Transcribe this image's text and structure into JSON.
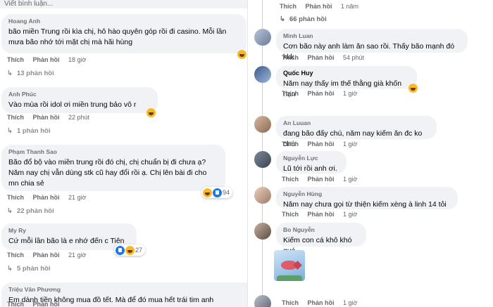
{
  "left": {
    "write_placeholder": "Viết bình luận...",
    "comments": [
      {
        "author": "Hoang Anh",
        "text": "bão miền Trung rồi kìa chị, hô hào quyên góp rồi đi casino. Mỗi lần mưa bão nhớ tới mặt chị mà hãi hùng",
        "like": "Thích",
        "reply": "Phản hồi",
        "time": "18 giờ",
        "replies": "13 phản hồi"
      },
      {
        "author": "Anh Phúc",
        "text": "Vào mùa rồi idol ơi miền trung bảo vô r",
        "like": "Thích",
        "reply": "Phản hồi",
        "time": "22 phút",
        "replies": "1 phản hồi"
      },
      {
        "author": "Phạm Thanh Sao",
        "text": "Bão đổ bộ vào miền trung rồi đó chị, chị chuẩn bị đi chưa ạ? Năm nay chị vẫn dùng stk cũ hay đổi rồi ạ. Chị lên bài đi cho mn chia sẻ",
        "like": "Thích",
        "reply": "Phản hồi",
        "time": "21 giờ",
        "reaction_count": "94",
        "replies": "22 phản hồi"
      },
      {
        "author": "My Ry",
        "text": "Cứ mỗi lần bão là e nhớ đến c Tiên",
        "like": "Thích",
        "reply": "Phản hồi",
        "time": "21 giờ",
        "reaction_count": "27",
        "replies": "5 phản hồi"
      },
      {
        "author": "Triệu Văn Phương",
        "text": "Em dành tiền không mua đồ tết. Mà để đó mua hết trái tim anh",
        "like": "Thích",
        "reply": "Phản hồi"
      }
    ]
  },
  "right": {
    "top": {
      "like": "Thích",
      "reply": "Phản hồi",
      "time": "1 năm",
      "replies": "66 phản hồi"
    },
    "comments": [
      {
        "author": "Minh Luan",
        "text": "Cơn bão này anh làm ăn sao rồi. Thấy bão mạnh đó kkk",
        "like": "Thích",
        "reply": "Phản hồi",
        "time": "54 phút"
      },
      {
        "author": "Quốc Huy",
        "text": "Năm nay thấy im thế thằng già khốn nạn",
        "like": "Thích",
        "reply": "Phản hồi",
        "time": "1 giờ"
      },
      {
        "author": "An Luuan",
        "text": "đang bão đấy chú, năm nay kiếm ăn đc ko chú",
        "like": "Thích",
        "reply": "Phản hồi",
        "time": "1 giờ"
      },
      {
        "author": "Nguyễn Lực",
        "text": "Lũ tới rồi anh ơi.",
        "like": "Thích",
        "reply": "Phản hồi",
        "time": "1 giờ"
      },
      {
        "author": "Nguyễn Hùng",
        "text": "Năm nay chưa gọi từ thiện kiếm xèng à linh 14 tỏi",
        "like": "Thích",
        "reply": "Phản hồi",
        "time": "1 giờ"
      },
      {
        "author": "Bo Nguyễn",
        "text": "Kiếm con cá khô khó quá",
        "like": "Thích",
        "reply": "Phản hồi",
        "time": "1 giờ"
      },
      {
        "like": "Thích",
        "reply": "Phản hồi",
        "time": "1 giờ"
      }
    ]
  }
}
